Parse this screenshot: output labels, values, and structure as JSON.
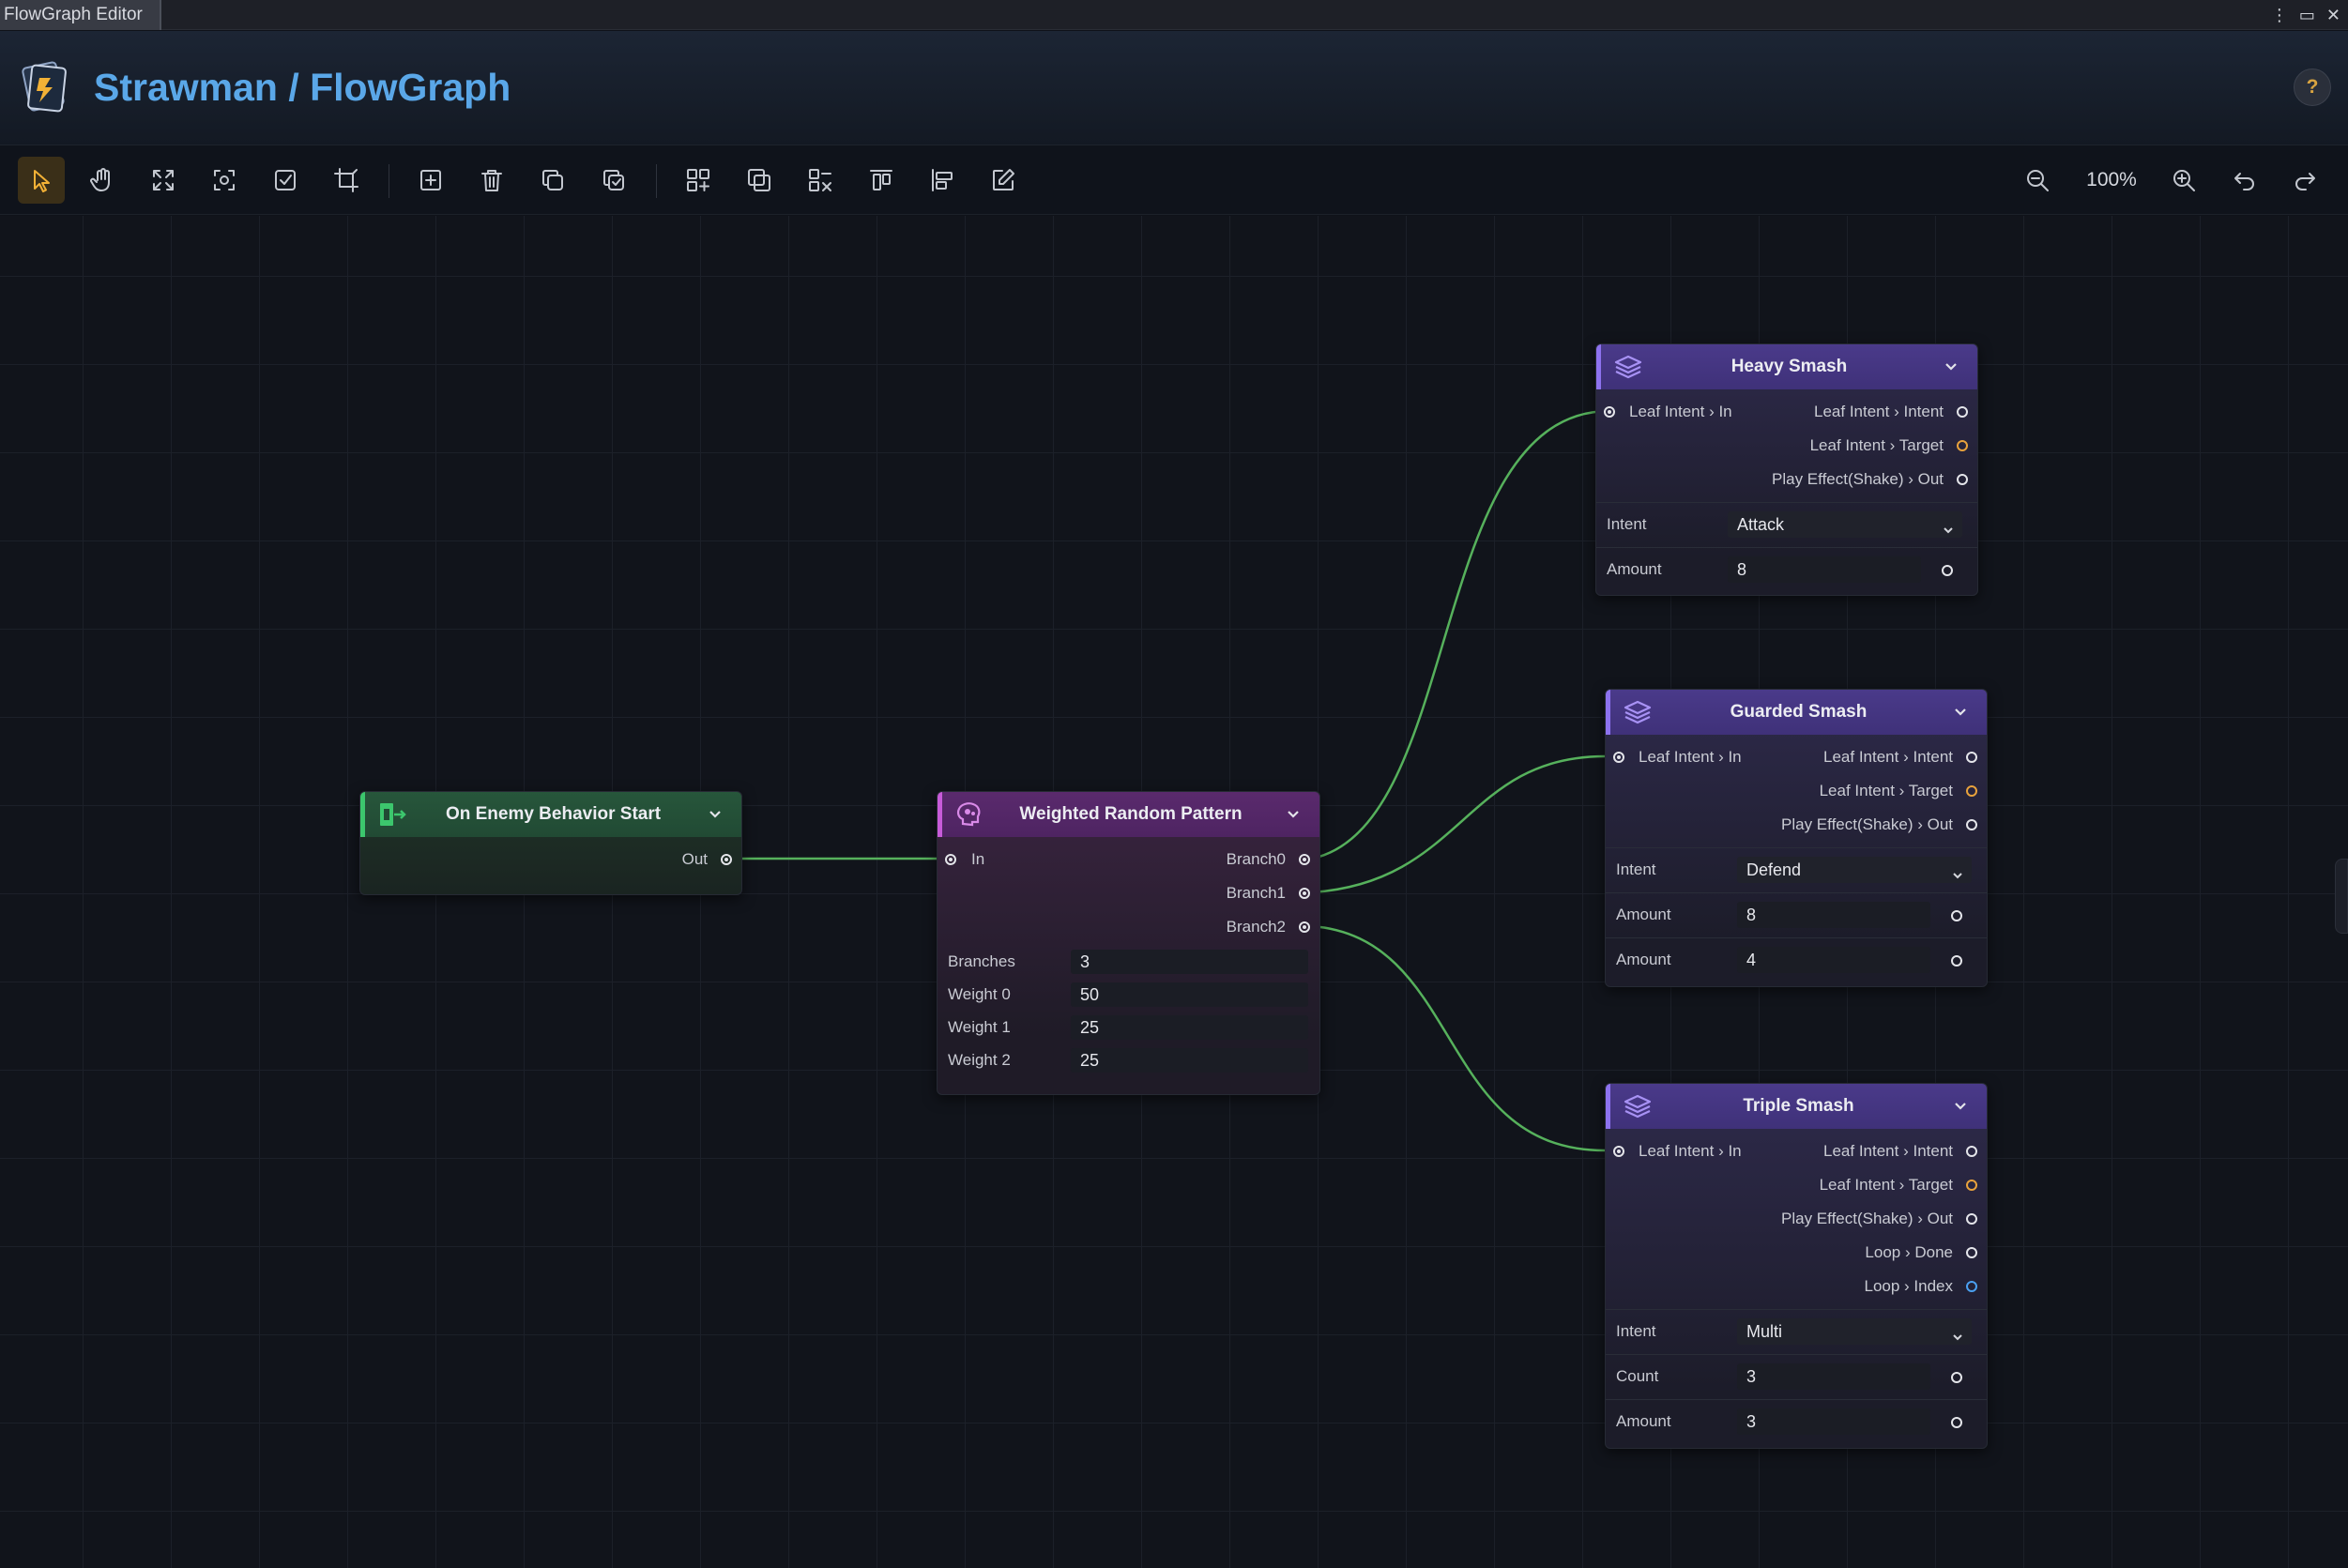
{
  "window": {
    "title": "FlowGraph Editor",
    "controls": [
      "⋮",
      "▭",
      "✕"
    ]
  },
  "header": {
    "breadcrumb": "Strawman / FlowGraph",
    "help_label": "?"
  },
  "toolbar": {
    "zoom_level": "100%",
    "tools": [
      "select",
      "pan",
      "expand",
      "focus",
      "check",
      "crop",
      "add-node",
      "delete",
      "duplicate",
      "copy",
      "group",
      "frame",
      "ungroup",
      "align-top",
      "align-left",
      "edit",
      "zoom-out",
      "zoom-in",
      "undo",
      "redo"
    ]
  },
  "colors": {
    "accent": "#5aa7e8",
    "wire": "#56b15c",
    "start": "#3cc66d",
    "random": "#c75bd9",
    "leaf": "#8d72ef"
  },
  "nodes": {
    "start": {
      "title": "On Enemy Behavior Start",
      "out_label": "Out"
    },
    "random": {
      "title": "Weighted Random Pattern",
      "in_label": "In",
      "outputs": [
        "Branch0",
        "Branch1",
        "Branch2"
      ],
      "fields": [
        {
          "label": "Branches",
          "value": "3"
        },
        {
          "label": "Weight 0",
          "value": "50"
        },
        {
          "label": "Weight 1",
          "value": "25"
        },
        {
          "label": "Weight 2",
          "value": "25"
        }
      ]
    },
    "heavy": {
      "title": "Heavy Smash",
      "in_label": "Leaf Intent › In",
      "outputs": [
        "Leaf Intent › Intent",
        "Leaf Intent › Target",
        "Play Effect(Shake) › Out"
      ],
      "intent_label": "Intent",
      "intent_value": "Attack",
      "amount_label": "Amount",
      "amount_value": "8"
    },
    "guarded": {
      "title": "Guarded Smash",
      "in_label": "Leaf Intent › In",
      "outputs": [
        "Leaf Intent › Intent",
        "Leaf Intent › Target",
        "Play Effect(Shake) › Out"
      ],
      "intent_label": "Intent",
      "intent_value": "Defend",
      "amount1_label": "Amount",
      "amount1_value": "8",
      "amount2_label": "Amount",
      "amount2_value": "4"
    },
    "triple": {
      "title": "Triple Smash",
      "in_label": "Leaf Intent › In",
      "outputs": [
        "Leaf Intent › Intent",
        "Leaf Intent › Target",
        "Play Effect(Shake) › Out",
        "Loop › Done",
        "Loop › Index"
      ],
      "intent_label": "Intent",
      "intent_value": "Multi",
      "count_label": "Count",
      "count_value": "3",
      "amount_label": "Amount",
      "amount_value": "3"
    }
  }
}
